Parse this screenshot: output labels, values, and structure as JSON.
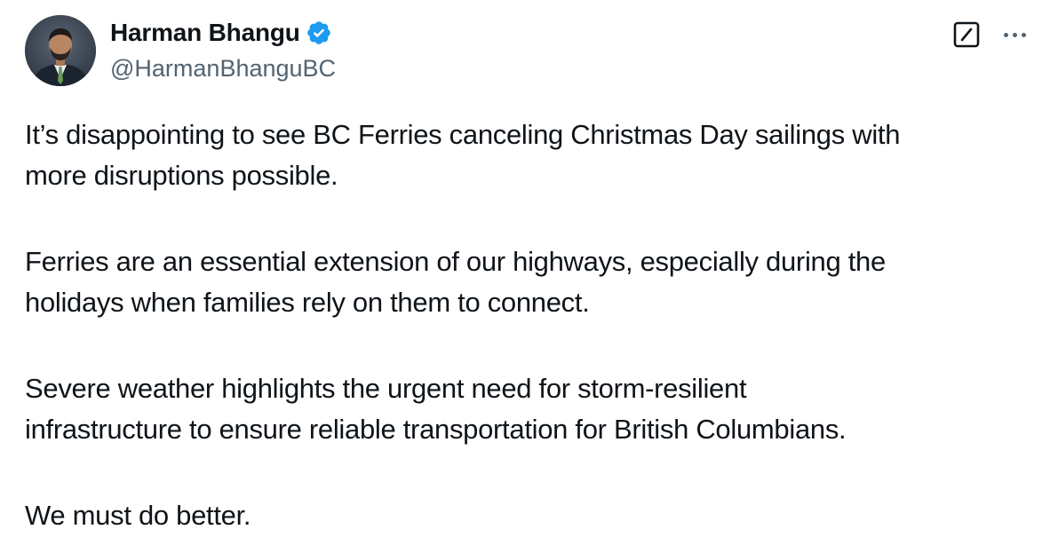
{
  "author": {
    "display_name": "Harman Bhangu",
    "handle": "@HarmanBhanguBC",
    "verified": true,
    "verified_color": "#1d9bf0",
    "avatar_icon": "profile-photo"
  },
  "actions": {
    "grok_icon": "grok-icon",
    "more_icon": "more-horizontal-icon"
  },
  "tweet": {
    "lines": [
      [
        "It’s disappointing to see BC Ferries canceling Christmas Day sailings with",
        "more disruptions possible."
      ],
      [
        "Ferries are an essential extension of our highways, especially during the",
        "holidays when families rely on them to connect."
      ],
      [
        "Severe weather highlights the urgent need for storm-resilient",
        "infrastructure to ensure reliable transportation for British Columbians."
      ],
      [
        "We must do better."
      ]
    ]
  },
  "colors": {
    "text_primary": "#0f1419",
    "text_secondary": "#536471",
    "background": "#ffffff"
  }
}
